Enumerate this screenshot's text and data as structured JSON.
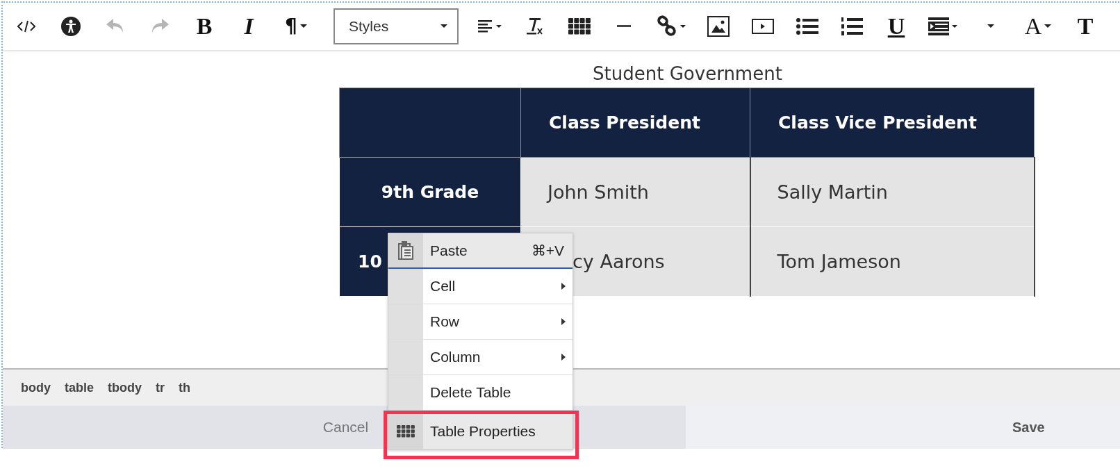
{
  "toolbar": [
    {
      "kind": "code",
      "disabled": false
    },
    {
      "kind": "accessibility",
      "disabled": false
    },
    {
      "kind": "undo",
      "disabled": true
    },
    {
      "kind": "redo",
      "disabled": true
    },
    {
      "kind": "bold",
      "glyph": "B",
      "disabled": false
    },
    {
      "kind": "italic",
      "glyph": "I",
      "disabled": false
    },
    {
      "kind": "paragraph",
      "glyph": "¶",
      "disabled": false
    },
    {
      "kind": "select",
      "value": "Styles"
    },
    {
      "kind": "align",
      "disabled": false
    },
    {
      "kind": "clear-format",
      "disabled": false
    },
    {
      "kind": "table",
      "disabled": false
    },
    {
      "kind": "rule",
      "disabled": false
    },
    {
      "kind": "link",
      "disabled": false
    },
    {
      "kind": "image",
      "disabled": false
    },
    {
      "kind": "video",
      "disabled": false
    },
    {
      "kind": "bullets",
      "disabled": false
    },
    {
      "kind": "numbers",
      "disabled": false
    },
    {
      "kind": "underline",
      "glyph": "U",
      "disabled": false
    },
    {
      "kind": "indent",
      "disabled": false
    },
    {
      "kind": "caret",
      "disabled": false
    },
    {
      "kind": "font-color",
      "glyph": "A",
      "disabled": false
    },
    {
      "kind": "font-size",
      "glyph": "T",
      "disabled": false
    }
  ],
  "caption": "Student Government",
  "table": {
    "columns": [
      "",
      "Class President",
      "Class Vice President"
    ],
    "rows": [
      {
        "cells": [
          "9th Grade",
          "John Smith",
          "Sally Martin"
        ]
      },
      {
        "cells": [
          "10",
          "cy Aarons",
          "Tom Jameson"
        ]
      }
    ]
  },
  "path": [
    "body",
    "table",
    "tbody",
    "tr",
    "th"
  ],
  "buttons": {
    "cancel": "Cancel",
    "save": "Save"
  },
  "context_menu": [
    {
      "label": "Paste",
      "shortcut": "⌘+V",
      "kind": "paste",
      "selected": true,
      "submenu": false,
      "outlined": false
    },
    {
      "label": "Cell",
      "kind": "plain",
      "selected": false,
      "submenu": true,
      "outlined": false
    },
    {
      "label": "Row",
      "kind": "plain",
      "selected": false,
      "submenu": true,
      "outlined": false
    },
    {
      "label": "Column",
      "kind": "plain",
      "selected": false,
      "submenu": true,
      "outlined": false
    },
    {
      "label": "Delete Table",
      "kind": "plain",
      "selected": false,
      "submenu": false,
      "outlined": false
    },
    {
      "label": "Table Properties",
      "kind": "table",
      "selected": true,
      "submenu": false,
      "outlined": true
    }
  ]
}
